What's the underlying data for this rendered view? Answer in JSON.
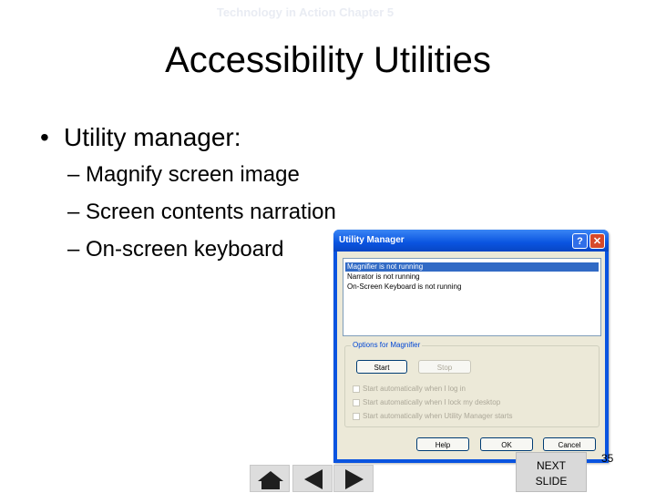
{
  "header": {
    "text": "Technology in Action Chapter 5"
  },
  "slide": {
    "title": "Accessibility Utilities",
    "bullet": "Utility manager:",
    "sub_items": [
      "– Magnify screen image",
      "– Screen contents narration",
      "– On-screen keyboard"
    ]
  },
  "window": {
    "title": "Utility Manager",
    "help_glyph": "?",
    "close_glyph": "✕",
    "list_items": [
      "Magnifier is not running",
      "Narrator is not running",
      "On-Screen Keyboard is not running"
    ],
    "group_label": "Options for Magnifier",
    "start_label": "Start",
    "stop_label": "Stop",
    "options": [
      "Start automatically when I log in",
      "Start automatically when I lock my desktop",
      "Start automatically when Utility Manager starts"
    ],
    "help_label": "Help",
    "ok_label": "OK",
    "cancel_label": "Cancel"
  },
  "footer": {
    "next_line1": "NEXT",
    "next_line2": "SLIDE",
    "page_number": "35"
  },
  "colors": {
    "titlebar": "#0a54e0",
    "selection": "#316ac5",
    "dialog_bg": "#ece9d8"
  },
  "icons": [
    "home-icon",
    "prev-arrow-icon",
    "next-arrow-icon",
    "help-icon",
    "close-icon"
  ]
}
